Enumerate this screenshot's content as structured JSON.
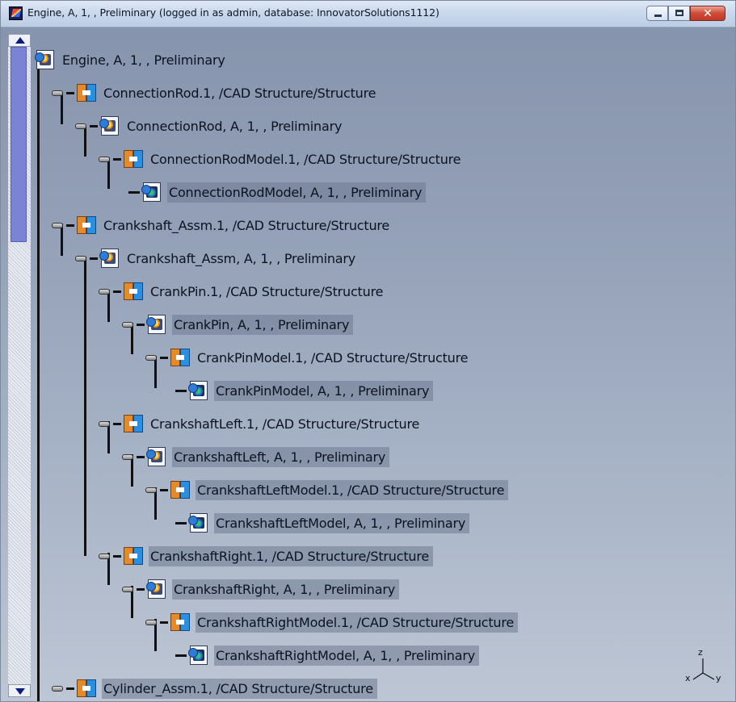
{
  "window": {
    "title": "Engine, A, 1, , Preliminary (logged in as admin, database: InnovatorSolutions1112)",
    "controls": {
      "minimize_icon": "minimize-icon",
      "maximize_icon": "maximize-icon",
      "close_icon": "close-icon",
      "close_glyph": "✕"
    }
  },
  "tree": {
    "nodes": [
      {
        "label": "Engine, A, 1, , Preliminary",
        "type": "product"
      },
      {
        "label": "ConnectionRod.1, /CAD Structure/Structure",
        "type": "instance"
      },
      {
        "label": "ConnectionRod, A, 1, , Preliminary",
        "type": "product"
      },
      {
        "label": "ConnectionRodModel.1, /CAD Structure/Structure",
        "type": "instance"
      },
      {
        "label": "ConnectionRodModel, A, 1, , Preliminary",
        "type": "part"
      },
      {
        "label": "Crankshaft_Assm.1, /CAD Structure/Structure",
        "type": "instance"
      },
      {
        "label": "Crankshaft_Assm, A, 1, , Preliminary",
        "type": "product"
      },
      {
        "label": "CrankPin.1, /CAD Structure/Structure",
        "type": "instance"
      },
      {
        "label": "CrankPin, A, 1, , Preliminary",
        "type": "product"
      },
      {
        "label": "CrankPinModel.1, /CAD Structure/Structure",
        "type": "instance"
      },
      {
        "label": "CrankPinModel, A, 1, , Preliminary",
        "type": "part"
      },
      {
        "label": "CrankshaftLeft.1, /CAD Structure/Structure",
        "type": "instance"
      },
      {
        "label": "CrankshaftLeft, A, 1, , Preliminary",
        "type": "product"
      },
      {
        "label": "CrankshaftLeftModel.1, /CAD Structure/Structure",
        "type": "instance"
      },
      {
        "label": "CrankshaftLeftModel, A, 1, , Preliminary",
        "type": "part"
      },
      {
        "label": "CrankshaftRight.1, /CAD Structure/Structure",
        "type": "instance"
      },
      {
        "label": "CrankshaftRight, A, 1, , Preliminary",
        "type": "product"
      },
      {
        "label": "CrankshaftRightModel.1, /CAD Structure/Structure",
        "type": "instance"
      },
      {
        "label": "CrankshaftRightModel, A, 1, , Preliminary",
        "type": "part"
      },
      {
        "label": "Cylinder_Assm.1, /CAD Structure/Structure",
        "type": "instance"
      }
    ]
  },
  "triad": {
    "z": "z",
    "x": "x",
    "y": "y"
  }
}
